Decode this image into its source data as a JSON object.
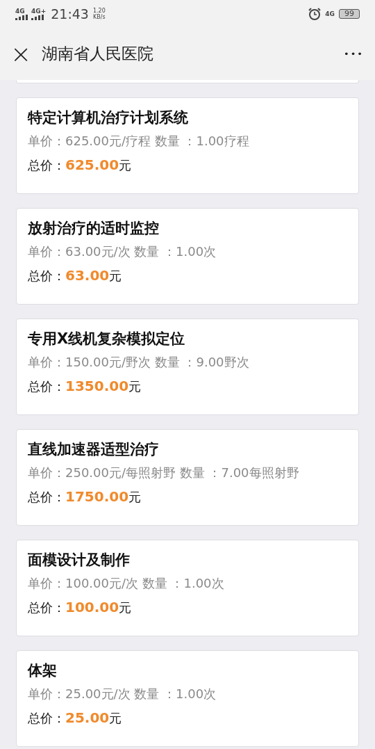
{
  "status_bar": {
    "signal_1": "4G",
    "signal_2": "4G+",
    "time": "21:43",
    "speed_value": "1.20",
    "speed_unit": "KB/s",
    "network": "4G",
    "battery": "99"
  },
  "header": {
    "close": "×",
    "title": "湖南省人民医院",
    "more": "•••"
  },
  "items": [
    {
      "name": "特定计算机治疗计划系统",
      "detail": "单价：625.00元/疗程 数量 ：1.00疗程",
      "total_label": "总价：",
      "total_amount": "625.00",
      "total_unit": "元"
    },
    {
      "name": "放射治疗的适时监控",
      "detail": "单价：63.00元/次 数量 ：1.00次",
      "total_label": "总价：",
      "total_amount": "63.00",
      "total_unit": "元"
    },
    {
      "name": "专用X线机复杂模拟定位",
      "detail": "单价：150.00元/野次 数量 ：9.00野次",
      "total_label": "总价：",
      "total_amount": "1350.00",
      "total_unit": "元"
    },
    {
      "name": "直线加速器适型治疗",
      "detail": "单价：250.00元/每照射野 数量 ：7.00每照射野",
      "total_label": "总价：",
      "total_amount": "1750.00",
      "total_unit": "元"
    },
    {
      "name": "面模设计及制作",
      "detail": "单价：100.00元/次 数量 ：1.00次",
      "total_label": "总价：",
      "total_amount": "100.00",
      "total_unit": "元"
    },
    {
      "name": "体架",
      "detail": "单价：25.00元/次 数量 ：1.00次",
      "total_label": "总价：",
      "total_amount": "25.00",
      "total_unit": "元"
    }
  ]
}
